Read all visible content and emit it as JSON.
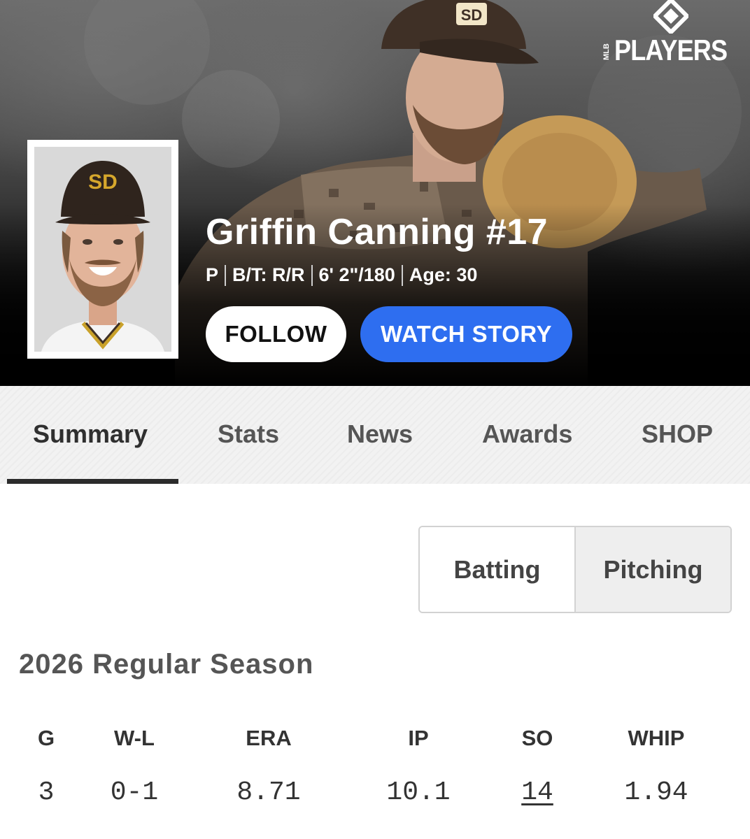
{
  "brand": {
    "logo_small_text": "MLB",
    "logo_text": "PLAYERS",
    "accent_color": "#2e6ef0"
  },
  "player": {
    "name_number": "Griffin Canning #17",
    "position": "P",
    "bats_throws": "B/T: R/R",
    "height_weight": "6' 2\"/180",
    "age": "Age: 30",
    "headshot_icon": "player-headshot",
    "hero_image_icon": "pitcher-action-photo"
  },
  "actions": {
    "follow_label": "FOLLOW",
    "watch_story_label": "WATCH STORY"
  },
  "tabs": [
    {
      "label": "Summary",
      "active": true
    },
    {
      "label": "Stats",
      "active": false
    },
    {
      "label": "News",
      "active": false
    },
    {
      "label": "Awards",
      "active": false
    },
    {
      "label": "SHOP",
      "active": false
    }
  ],
  "stat_type_toggle": {
    "batting_label": "Batting",
    "pitching_label": "Pitching",
    "selected": "Pitching"
  },
  "season": {
    "title": "2026 Regular Season",
    "headers": [
      "G",
      "W-L",
      "ERA",
      "IP",
      "SO",
      "WHIP"
    ],
    "values": [
      "3",
      "0-1",
      "8.71",
      "10.1",
      "14",
      "1.94"
    ]
  }
}
